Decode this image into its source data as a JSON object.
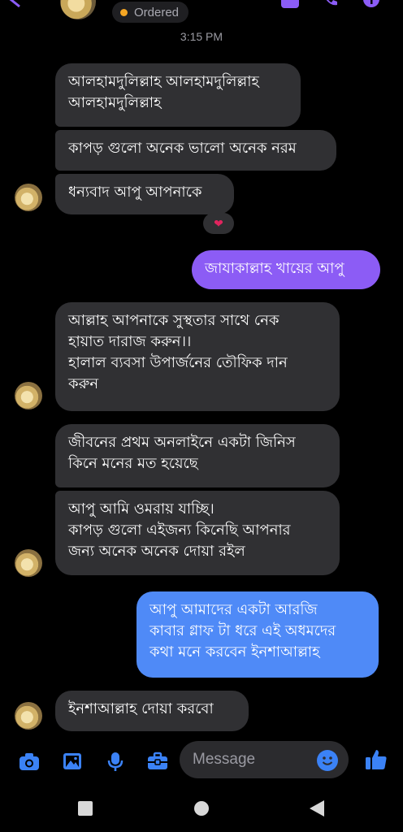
{
  "header": {
    "status_label": "Ordered",
    "status_color": "#f5a623"
  },
  "timestamp": "3:15 PM",
  "messages": [
    {
      "text": "আলহামদুলিল্লাহ আলহামদুলিল্লাহ\nআলহামদুলিল্লাহ",
      "sender": "contact"
    },
    {
      "text": "কাপড় গুলো অনেক ভালো অনেক নরম",
      "sender": "contact"
    },
    {
      "text": "ধন্যবাদ আপু আপনাকে",
      "sender": "contact",
      "reaction": "❤"
    },
    {
      "text": "জাযাকাল্লাহ খায়ের আপু",
      "sender": "me"
    },
    {
      "text": "আল্লাহ আপনাকে সুস্থতার সাথে নেক\nহায়াত দারাজ করুন।।\nহালাল ব্যবসা উপার্জনের তৌফিক দান\nকরুন",
      "sender": "contact"
    },
    {
      "text": "জীবনের প্রথম অনলাইনে একটা জিনিস\nকিনে মনের মত হয়েছে",
      "sender": "contact"
    },
    {
      "text": "আপু আমি ওমরায় যাচ্ছি।\nকাপড় গুলো এইজন্য কিনেছি আপনার\nজন্য অনেক অনেক দোয়া রইল",
      "sender": "contact"
    },
    {
      "text": "আপু  আমাদের একটা আরজি\nকাবার গ্লাফ টা ধরে এই অধমদের\nকথা মনে করবেন ইনশাআল্লাহ",
      "sender": "me"
    },
    {
      "text": "ইনশাআল্লাহ দোয়া করবো",
      "sender": "contact"
    }
  ],
  "composer": {
    "placeholder": "Message",
    "icons": [
      "camera-icon",
      "gallery-icon",
      "microphone-icon",
      "toolbox-icon",
      "emoji-icon",
      "thumbs-up-icon"
    ],
    "accent": "#3b82f6"
  },
  "colors": {
    "incoming_bubble": "#303033",
    "outgoing_purple": "#8c5cf5",
    "outgoing_blue": "#4f8af7"
  }
}
